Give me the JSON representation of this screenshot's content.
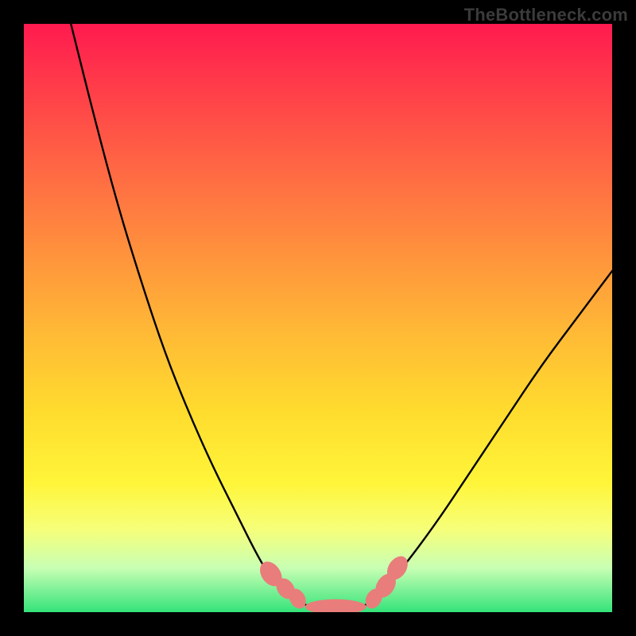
{
  "watermark": "TheBottleneck.com",
  "colors": {
    "frame": "#000000",
    "curve": "#000000",
    "marker": "#e97d7b",
    "gradient_stops": [
      "#ff1a4f",
      "#ff3a4a",
      "#ff6644",
      "#ff8f3d",
      "#ffb836",
      "#ffdc2e",
      "#fff539",
      "#f6ff7a",
      "#c8ffb4",
      "#34e37a"
    ]
  },
  "chart_data": {
    "type": "line",
    "title": "",
    "xlabel": "",
    "ylabel": "",
    "xlim": [
      0,
      100
    ],
    "ylim": [
      0,
      100
    ],
    "grid": false,
    "series": [
      {
        "name": "left-curve",
        "x": [
          8,
          12,
          16,
          20,
          24,
          28,
          32,
          36,
          40,
          42,
          44,
          46,
          48
        ],
        "y": [
          100,
          84,
          69,
          56,
          44,
          34,
          25,
          17,
          9,
          6,
          4,
          2.2,
          1.2
        ]
      },
      {
        "name": "valley-floor",
        "x": [
          48,
          50,
          52,
          54,
          56,
          58
        ],
        "y": [
          1.2,
          0.8,
          0.7,
          0.7,
          0.8,
          1.2
        ]
      },
      {
        "name": "right-curve",
        "x": [
          58,
          60,
          64,
          70,
          76,
          82,
          88,
          94,
          100
        ],
        "y": [
          1.2,
          2.5,
          7,
          15,
          24,
          33,
          42,
          50,
          58
        ]
      }
    ],
    "markers": [
      {
        "name": "left-dot-1",
        "cx": 42.0,
        "cy": 6.5,
        "rx": 1.6,
        "ry": 2.3,
        "rot": -35
      },
      {
        "name": "left-dot-2",
        "cx": 44.5,
        "cy": 4.0,
        "rx": 1.4,
        "ry": 1.9,
        "rot": -35
      },
      {
        "name": "left-dot-3",
        "cx": 46.5,
        "cy": 2.3,
        "rx": 1.3,
        "ry": 1.8,
        "rot": -30
      },
      {
        "name": "floor-pill",
        "cx": 53.0,
        "cy": 0.9,
        "rx": 5.2,
        "ry": 1.3,
        "rot": 0
      },
      {
        "name": "right-dot-1",
        "cx": 59.5,
        "cy": 2.3,
        "rx": 1.3,
        "ry": 1.8,
        "rot": 30
      },
      {
        "name": "right-dot-2",
        "cx": 61.5,
        "cy": 4.5,
        "rx": 1.5,
        "ry": 2.2,
        "rot": 32
      },
      {
        "name": "right-dot-3",
        "cx": 63.5,
        "cy": 7.5,
        "rx": 1.5,
        "ry": 2.2,
        "rot": 34
      }
    ]
  }
}
